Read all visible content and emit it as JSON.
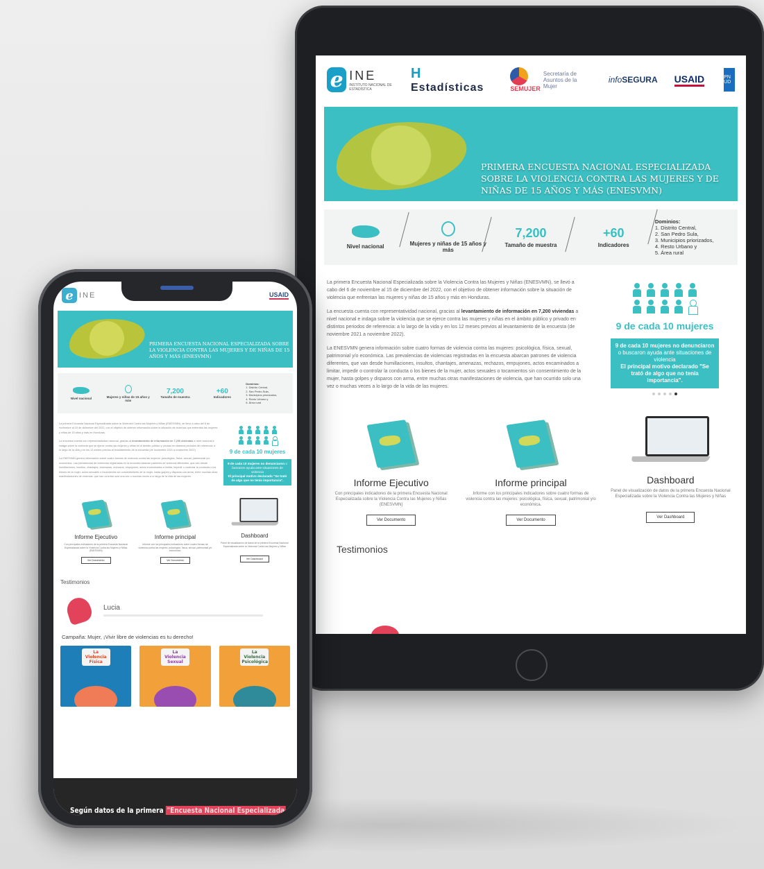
{
  "header": {
    "ine_letter": "e",
    "ine_name": "INE",
    "ine_sub": "INSTITUTO NACIONAL DE ESTADÍSTICA",
    "est_mark": "H",
    "est_name": "Estadísticas",
    "semujer_name": "SEMUJER",
    "semujer_secretaria": "Secretaría de Asuntos de la Mujer",
    "info_prefix": "info",
    "info_name": "SEGURA",
    "usaid": "USAID",
    "undp": "PN UD"
  },
  "banner": {
    "title": "PRIMERA ENCUESTA NACIONAL ESPECIALIZADA SOBRE LA VIOLENCIA CONTRA LAS MUJERES Y DE NIÑAS DE 15 AÑOS Y MÁS (ENESVMN)"
  },
  "stats": {
    "nivel": "Nivel nacional",
    "mujeres": "Mujeres y niñas de 15 años y más",
    "tamano_num": "7,200",
    "tamano_label": "Tamaño de muestra",
    "ind_num": "+60",
    "ind_label": "Indicadores",
    "dominios_title": "Dominios:",
    "dominios": [
      "1. Distrito Central,",
      "2. San Pedro Sula,",
      "3. Municipios priorizados,",
      "4. Resto Urbano y",
      "5. Área rural"
    ]
  },
  "intro": {
    "p1": "La primera Encuesta Nacional Especializada sobre la Violencia Contra las Mujeres y Niñas (ENESVMN), se llevó a cabo del 6 de noviembre al 15 de diciembre del 2022, con el objetivo de obtener información sobre la situación de violencia que enfrentan las mujeres y niñas de 15 años y más en Honduras.",
    "p2_a": "La encuesta cuenta con representatividad nacional, gracias al ",
    "p2_b": "levantamiento de información en 7,200 viviendas",
    "p2_c": " a nivel nacional e indaga sobre la violencia que se ejerce contra las mujeres y niñas en el ámbito público y privado en distintos periodos de referencia: a lo largo de la vida y en los 12 meses previos al levantamiento de la encuesta (de noviembre 2021 a noviembre 2022).",
    "p3": "La ENESVMN genera información sobre cuatro formas de violencia contra las mujeres: psicológica, física, sexual, patrimonial y/o económica. Las prevalencias de violencias registradas en la encuesta abarcan patrones de violencia diferentes, que van desde humillaciones, insultos, chantajes, amenazas, rechazos, empujones, actos encaminados a limitar, impedir o controlar la conducta o los bienes de la mujer, actos sexuales o tocamientos sin consentimiento de la mujer, hasta golpes y disparos con arma, entre muchas otras manifestaciones de violencia, que han ocurrido solo una vez o muchas veces a lo largo de la vida de las mujeres."
  },
  "side": {
    "big": "9 de cada 10 mujeres",
    "box_a": "9 de cada 10 mujeres no denunciaron",
    "box_b": " o buscaron ayuda ante situaciones de violencia",
    "box_c": "El principal motivo declarado \"Se trató de algo que no tenía importancia\"."
  },
  "cards": [
    {
      "title": "Informe Ejecutivo",
      "desc": "Con principales indicadores de la primera Encuesta Nacional Especializada sobre la Violencia Contra las Mujeres y Niñas (ENESVMN)",
      "button": "Ver Documento"
    },
    {
      "title": "Informe principal",
      "desc": "Informe con los principales indicadores sobre cuatro formas de violencia contra las mujeres: psicológica, física, sexual, patrimonial y/o económica.",
      "button": "Ver Documento"
    },
    {
      "title": "Dashboard",
      "desc": "Panel de visualización de datos de la primera Encuesta Nacional Especializada sobre la Violencia Contra las Mujeres y Niñas",
      "button": "Ver Dashboard"
    }
  ],
  "testimonios": {
    "title": "Testimonios",
    "name": "Lucia"
  },
  "campaign": {
    "title": "Campaña: Mujer, ¡Vivir libre de violencias es tu derecho!",
    "posters": [
      "La Violencia Física",
      "La Violencia Sexual",
      "La Violencia Psicológica"
    ]
  },
  "footer": {
    "text_a": "Según datos de la primera ",
    "text_b": "\"Encuesta Nacional Especializada"
  },
  "colors": {
    "accent": "#3bbfc2",
    "map_green": "#c6cf48",
    "red": "#e3435a"
  }
}
